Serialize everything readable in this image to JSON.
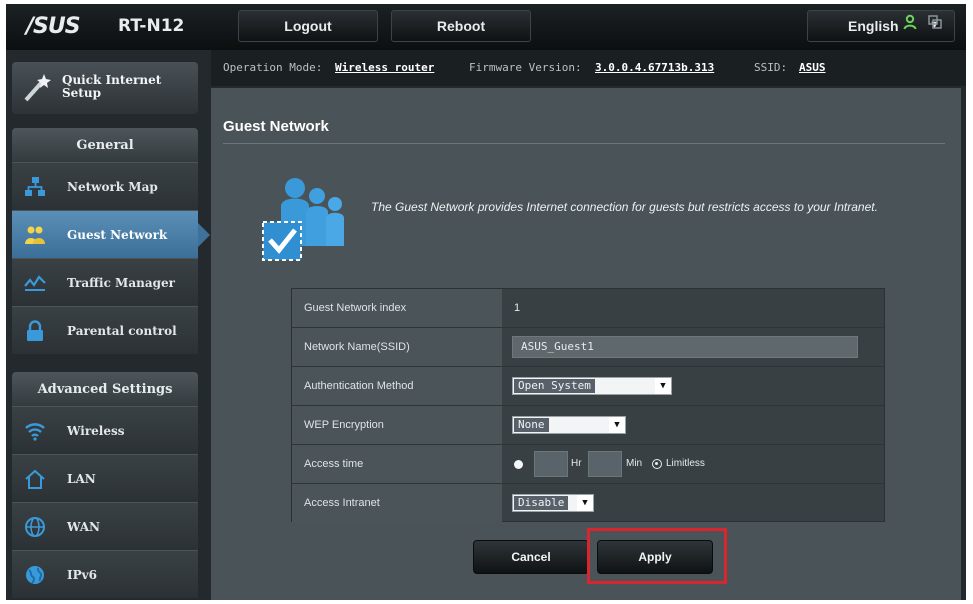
{
  "header": {
    "brand": "/SUS",
    "model": "RT-N12",
    "logout_label": "Logout",
    "reboot_label": "Reboot",
    "language": "English",
    "language_arrow": "▼"
  },
  "status": {
    "op_mode_label": "Operation Mode:",
    "op_mode_value": "Wireless router",
    "firmware_label": "Firmware Version:",
    "firmware_value": "3.0.0.4.67713b.313",
    "ssid_label": "SSID:",
    "ssid_value": "ASUS"
  },
  "sidebar": {
    "qis_label": "Quick Internet Setup",
    "general_title": "General",
    "general_items": [
      {
        "label": "Network Map",
        "icon": "network-map-icon"
      },
      {
        "label": "Guest Network",
        "icon": "guest-network-icon"
      },
      {
        "label": "Traffic Manager",
        "icon": "traffic-manager-icon"
      },
      {
        "label": "Parental control",
        "icon": "lock-icon"
      }
    ],
    "advanced_title": "Advanced Settings",
    "advanced_items": [
      {
        "label": "Wireless",
        "icon": "wifi-icon"
      },
      {
        "label": "LAN",
        "icon": "home-icon"
      },
      {
        "label": "WAN",
        "icon": "globe-icon"
      },
      {
        "label": "IPv6",
        "icon": "ipv6-globe-icon"
      }
    ],
    "active_item": "Guest Network"
  },
  "main": {
    "title": "Guest Network",
    "description": "The Guest Network provides Internet connection for guests but restricts access to your Intranet.",
    "rows": [
      {
        "label": "Guest Network index",
        "value": "1"
      },
      {
        "label": "Network Name(SSID)",
        "value": "ASUS_Guest1"
      },
      {
        "label": "Authentication Method",
        "value": "Open System"
      },
      {
        "label": "WEP Encryption",
        "value": "None"
      },
      {
        "label": "Access time",
        "hr_unit": "Hr",
        "min_unit": "Min",
        "limitless": "Limitless"
      },
      {
        "label": "Access Intranet",
        "value": "Disable"
      }
    ],
    "cancel_label": "Cancel",
    "apply_label": "Apply"
  },
  "colors": {
    "accent_active": "#4a80ab",
    "highlight_box": "#d9262e",
    "icon_blue": "#3a9ad9"
  }
}
